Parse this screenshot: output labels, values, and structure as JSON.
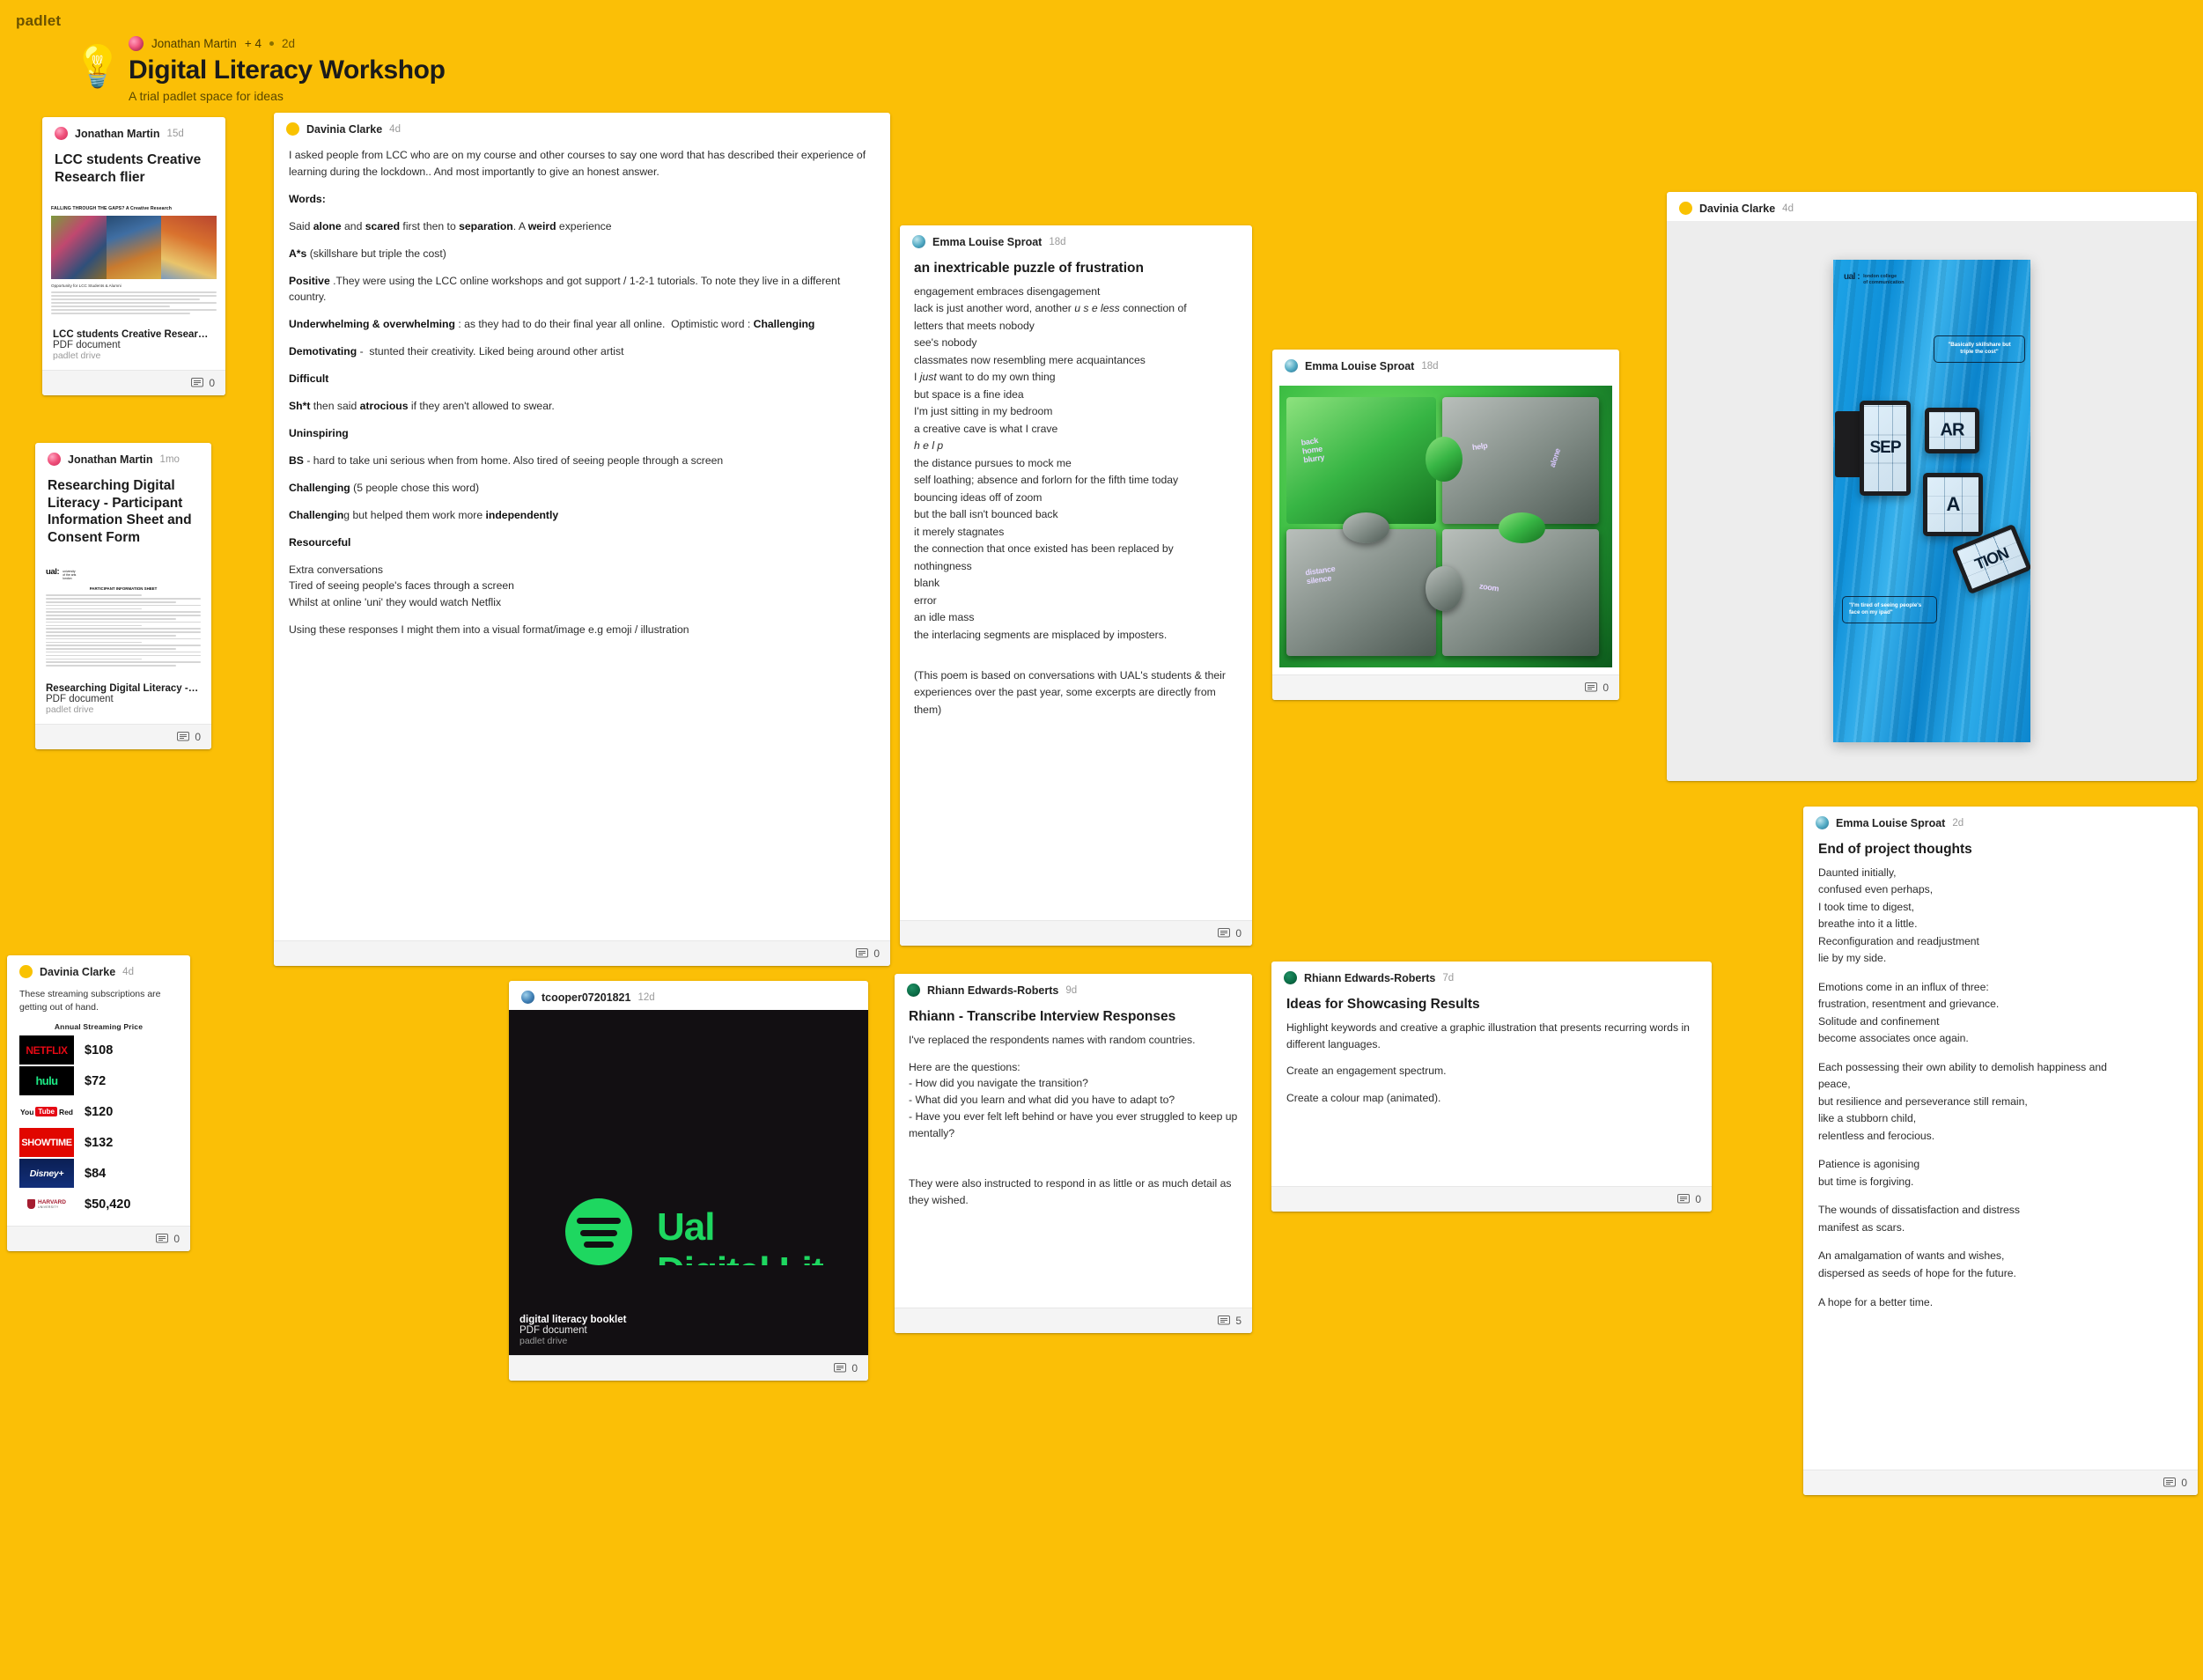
{
  "app": {
    "brand": "padlet"
  },
  "header": {
    "icon": "lightbulb-icon",
    "author": "Jonathan Martin",
    "collaborators": "+ 4",
    "time": "2d",
    "title": "Digital Literacy Workshop",
    "subtitle": "A trial padlet space for ideas"
  },
  "cards": {
    "flier": {
      "author": "Jonathan Martin",
      "time": "15d",
      "title": "LCC students Creative Research flier",
      "preview_heading": "FALLING THROUGH THE GAPS? A Creative Research",
      "preview_sub": "Opportunity for LCC Students & Alumni",
      "att_title": "LCC students Creative Resear…",
      "att_type": "PDF document",
      "att_source": "padlet drive",
      "comments": "0"
    },
    "consent": {
      "author": "Jonathan Martin",
      "time": "1mo",
      "title": "Researching Digital Literacy - Participant Information Sheet and Consent Form",
      "logo_main": "ual:",
      "logo_sub": "university\nof the arts\nlondon",
      "form_heading": "PARTICIPANT INFORMATION SHEET",
      "att_title": "Researching Digital Literacy - …",
      "att_type": "PDF document",
      "att_source": "padlet drive",
      "comments": "0"
    },
    "words": {
      "author": "Davinia Clarke",
      "time": "4d",
      "comments": "0",
      "paragraphs": [
        "I asked people from LCC who are on my course and other courses to say one word that has described their experience of learning during the lockdown.. And most importantly to give an honest answer.",
        "Words:",
        "Said alone and scared first then to separation. A weird experience",
        "A*s (skillshare but triple the cost)",
        "Positive .They were using the LCC online workshops and got support / 1-2-1 tutorials. To note they live in a different country.",
        "Underwhelming & overwhelming : as they had to do their final year all online.  Optimistic word : Challenging",
        "Demotivating -  stunted their creativity. Liked being around other artist",
        "Difficult",
        "Sh*t then said atrocious if they aren't allowed to swear.",
        "Uninspiring",
        "BS - hard to take uni serious when from home. Also tired of seeing people through a screen",
        "Challenging (5 people chose this word)",
        "Challenging but helped them work more independently",
        "Resourceful",
        "Extra conversations",
        "Tired of seeing people's faces through a screen",
        "Whilst at online 'uni' they would watch Netflix",
        "Using these responses I might them into a visual format/image e.g emoji / illustration"
      ]
    },
    "poem_puzzle": {
      "author": "Emma Louise Sproat",
      "time": "18d",
      "title": "an inextricable puzzle of frustration",
      "comments": "0",
      "lines": [
        "engagement embraces disengagement",
        "lack is just another word, another u s e less connection of",
        "letters that meets nobody",
        "see's nobody",
        "classmates now resembling mere acquaintances",
        "I just want to do my own thing",
        "but space is a fine idea",
        "I'm just sitting in my bedroom",
        "a creative cave is what I crave",
        "h e l p",
        "the distance pursues to mock me",
        "self loathing; absence and forlorn for the fifth time today",
        "bouncing ideas off of zoom",
        "but the ball isn't bounced back",
        "it merely stagnates",
        "the connection that once existed has been replaced by",
        "nothingness",
        "blank",
        "error",
        "an idle mass",
        "the interlacing segments are misplaced by imposters."
      ],
      "note": "(This poem is based on conversations with UAL's students & their experiences over the past year, some excerpts are directly from them)"
    },
    "puzzle_image": {
      "author": "Emma Louise Sproat",
      "time": "18d",
      "comments": "0",
      "alt": "green puzzle pieces artwork"
    },
    "ual_poster": {
      "author": "Davinia Clarke",
      "time": "4d",
      "comments": "",
      "poster_logo_main": "ual :",
      "poster_logo_sub": "london college\nof communication",
      "word_parts": [
        "SEP",
        "AR",
        "A",
        "TION"
      ],
      "quote_1": "\"Basically skillshare but triple the cost\"",
      "quote_2": "\"I'm tired of seeing people's face on my ipad\""
    },
    "streaming": {
      "author": "Davinia Clarke",
      "time": "4d",
      "note": "These streaming subscriptions are getting out of hand.",
      "chart_title": "Annual Streaming Price",
      "comments": "0",
      "rows": [
        {
          "service": "NETFLIX",
          "price": "$108"
        },
        {
          "service": "hulu",
          "price": "$72"
        },
        {
          "service": "YouTube Red",
          "price": "$120"
        },
        {
          "service": "SHOWTIME",
          "price": "$132"
        },
        {
          "service": "Disney+",
          "price": "$84"
        },
        {
          "service": "HARVARD UNIVERSITY",
          "price": "$50,420"
        }
      ]
    },
    "spotify": {
      "author": "tcooper07201821",
      "time": "12d",
      "cover_text": "Ual",
      "att_title": "digital literacy booklet",
      "att_type": "PDF document",
      "att_source": "padlet drive",
      "comments": "0"
    },
    "transcribe": {
      "author": "Rhiann Edwards-Roberts",
      "time": "9d",
      "title": "Rhiann - Transcribe Interview Responses",
      "comments": "5",
      "paragraphs": [
        "I've replaced the respondents names with random countries.",
        "Here are the questions:\n- How did you navigate the transition?\n- What did you learn and what did you have to adapt to?\n- Have you ever felt left behind or have you ever struggled to keep up mentally?",
        "They were also instructed to respond in as little or as much detail as they wished."
      ]
    },
    "showcasing": {
      "author": "Rhiann Edwards-Roberts",
      "time": "7d",
      "title": "Ideas for Showcasing Results",
      "comments": "0",
      "paragraphs": [
        "Highlight keywords and creative a graphic illustration that presents recurring words in different languages.",
        "Create an engagement spectrum.",
        "Create a colour map (animated)."
      ]
    },
    "end_thoughts": {
      "author": "Emma Louise Sproat",
      "time": "2d",
      "title": "End of project thoughts",
      "comments": "0",
      "lines": [
        "Daunted initially,",
        "confused even perhaps,",
        "I took time to digest,",
        "breathe into it a little.",
        "Reconfiguration and readjustment",
        "lie by my side.",
        "",
        "Emotions come in an influx of three:",
        "frustration, resentment and grievance.",
        "Solitude and confinement",
        "become associates once again.",
        "",
        "Each possessing their own ability to demolish happiness and",
        "peace,",
        "but resilience and perseverance still remain,",
        "like a stubborn child,",
        "relentless and ferocious.",
        "",
        "Patience is agonising",
        "but time is forgiving.",
        "",
        "The wounds of dissatisfaction and distress",
        "manifest as scars.",
        "",
        "An amalgamation of wants and wishes,",
        "dispersed as seeds of hope for the future.",
        "",
        "A hope for a better time."
      ]
    }
  },
  "colors": {
    "board_bg": "#FBBF06",
    "card_bg": "#FFFFFF",
    "footer_bg": "#F4F4F4"
  }
}
